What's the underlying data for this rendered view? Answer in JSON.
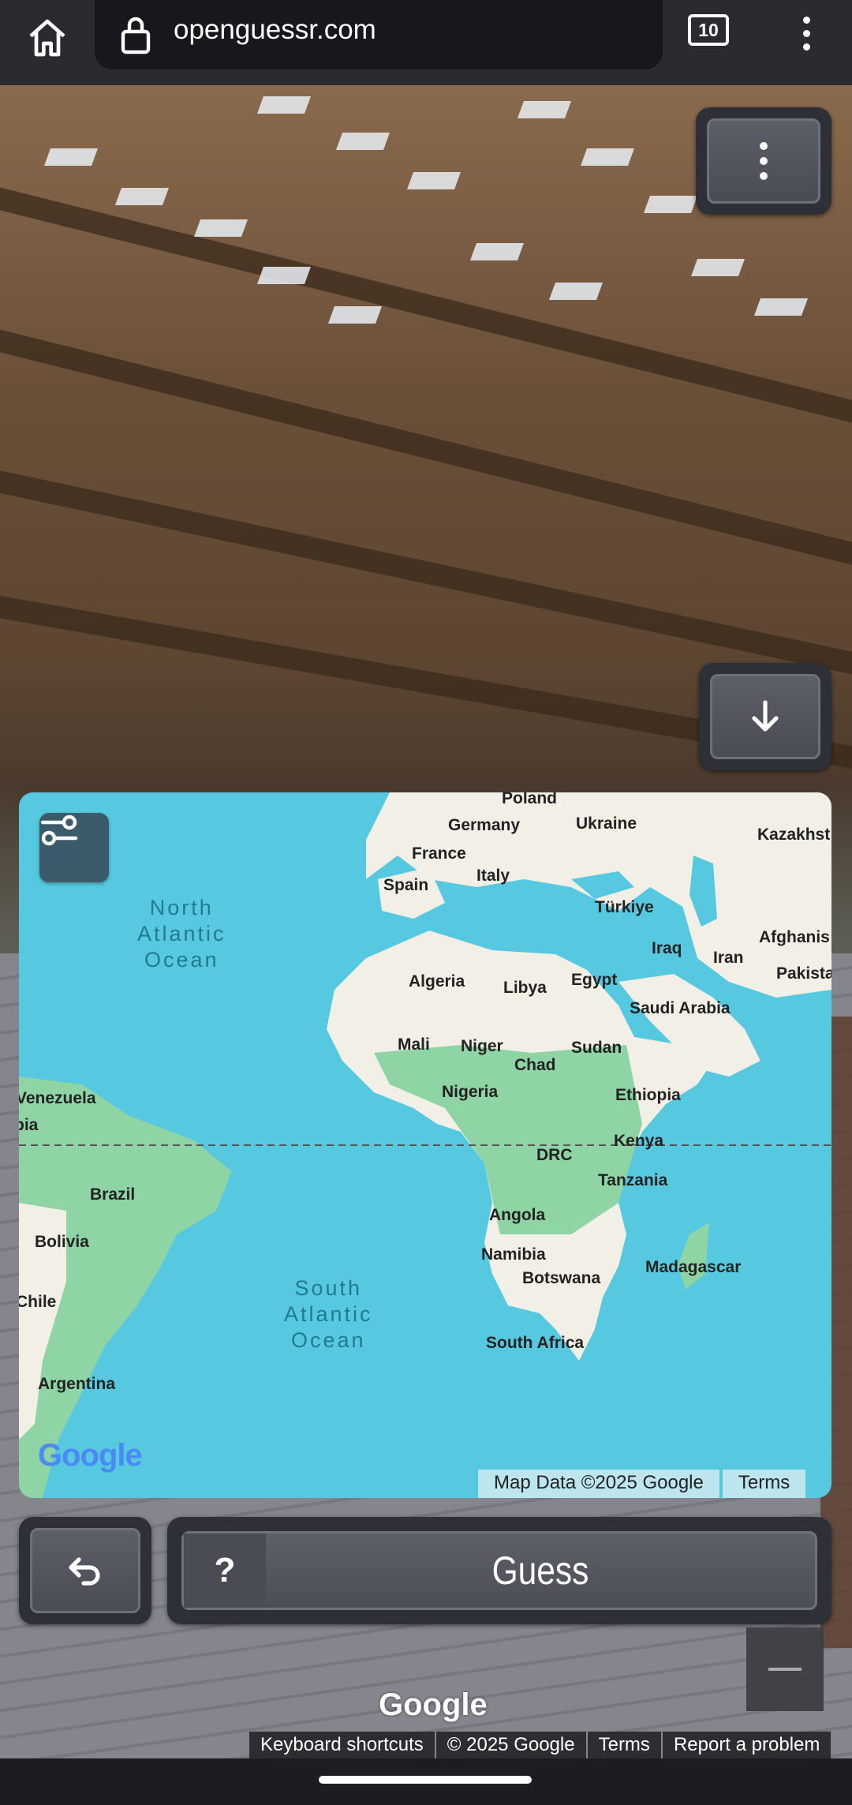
{
  "browser": {
    "url": "openguessr.com",
    "tab_count": "10"
  },
  "map": {
    "labels": {
      "poland": "Poland",
      "germany": "Germany",
      "ukraine": "Ukraine",
      "kazakhstan": "Kazakhst",
      "france": "France",
      "spain": "Spain",
      "italy": "Italy",
      "turkiye": "Türkiye",
      "iraq": "Iraq",
      "iran": "Iran",
      "afghanistan": "Afghanis",
      "pakistan": "Pakista",
      "algeria": "Algeria",
      "libya": "Libya",
      "egypt": "Egypt",
      "saudi_arabia": "Saudi Arabia",
      "mali": "Mali",
      "niger": "Niger",
      "chad": "Chad",
      "sudan": "Sudan",
      "nigeria": "Nigeria",
      "ethiopia": "Ethiopia",
      "venezuela": "Venezuela",
      "colombia": "bia",
      "drc": "DRC",
      "kenya": "Kenya",
      "brazil": "Brazil",
      "tanzania": "Tanzania",
      "angola": "Angola",
      "bolivia": "Bolivia",
      "namibia": "Namibia",
      "botswana": "Botswana",
      "madagascar": "Madagascar",
      "chile": "Chile",
      "south_africa": "South Africa",
      "argentina": "Argentina"
    },
    "oceans": {
      "north_atlantic": [
        "North",
        "Atlantic",
        "Ocean"
      ],
      "south_atlantic": [
        "South",
        "Atlantic",
        "Ocean"
      ]
    },
    "google_logo": "Google",
    "map_data": "Map Data ©2025 Google",
    "terms": "Terms"
  },
  "controls": {
    "question_mark": "?",
    "guess_label": "Guess"
  },
  "streetview": {
    "google_watermark": "Google",
    "footer": {
      "keyboard_shortcuts": "Keyboard shortcuts",
      "copyright": "© 2025 Google",
      "terms": "Terms",
      "report": "Report a problem"
    }
  },
  "colors": {
    "ocean": "#56c9e0",
    "land": "#f2efe6",
    "vegetation": "#8fd4a4",
    "button_frame": "#2e3038"
  }
}
